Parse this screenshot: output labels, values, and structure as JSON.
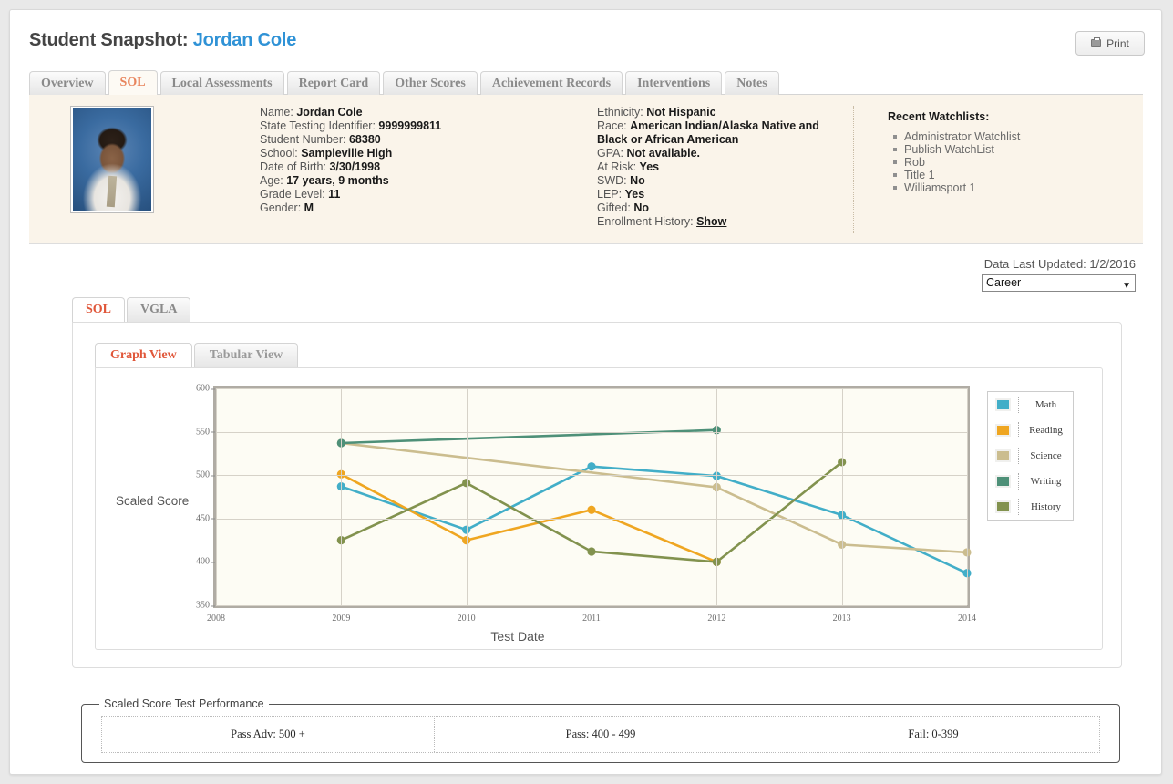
{
  "header": {
    "title_prefix": "Student Snapshot:",
    "student_name": "Jordan Cole",
    "print_label": "Print",
    "accent_link": "#2f92d6"
  },
  "main_tabs": [
    {
      "label": "Overview",
      "active": false
    },
    {
      "label": "SOL",
      "active": true
    },
    {
      "label": "Local Assessments",
      "active": false
    },
    {
      "label": "Report Card",
      "active": false
    },
    {
      "label": "Other Scores",
      "active": false
    },
    {
      "label": "Achievement Records",
      "active": false
    },
    {
      "label": "Interventions",
      "active": false
    },
    {
      "label": "Notes",
      "active": false
    }
  ],
  "student_info": {
    "left": [
      {
        "label": "Name:",
        "value": "Jordan Cole"
      },
      {
        "label": "State Testing Identifier:",
        "value": "9999999811"
      },
      {
        "label": "Student Number:",
        "value": "68380"
      },
      {
        "label": "School:",
        "value": "Sampleville High"
      },
      {
        "label": "Date of Birth:",
        "value": "3/30/1998"
      },
      {
        "label": "Age:",
        "value": "17 years, 9 months"
      },
      {
        "label": "Grade Level:",
        "value": "11"
      },
      {
        "label": "Gender:",
        "value": "M"
      }
    ],
    "right": [
      {
        "label": "Ethnicity:",
        "value": "Not Hispanic"
      },
      {
        "label": "Race:",
        "value": "American Indian/Alaska Native and Black or African American"
      },
      {
        "label": "GPA:",
        "value": "Not available."
      },
      {
        "label": "At Risk:",
        "value": "Yes"
      },
      {
        "label": "SWD:",
        "value": "No"
      },
      {
        "label": "LEP:",
        "value": "Yes"
      },
      {
        "label": "Gifted:",
        "value": "No"
      },
      {
        "label": "Enrollment History:",
        "value": "Show"
      }
    ]
  },
  "watchlists": {
    "title": "Recent Watchlists:",
    "items": [
      "Administrator Watchlist",
      "Publish WatchList",
      "Rob",
      "Title 1",
      "Williamsport 1"
    ]
  },
  "data_updated": "Data Last Updated: 1/2/2016",
  "career_select": {
    "value": "Career",
    "arrow": "▼"
  },
  "sub_tabs": [
    {
      "label": "SOL",
      "active": true
    },
    {
      "label": "VGLA",
      "active": false
    }
  ],
  "view_tabs": [
    {
      "label": "Graph View",
      "active": true
    },
    {
      "label": "Tabular View",
      "active": false
    }
  ],
  "performance": {
    "legend_title": "Scaled Score Test Performance",
    "cells": [
      "Pass Adv: 500 +",
      "Pass: 400 - 499",
      "Fail: 0-399"
    ]
  },
  "chart_data": {
    "type": "line",
    "title": "",
    "xlabel": "Test Date",
    "ylabel": "Scaled Score",
    "x": [
      2008,
      2009,
      2010,
      2011,
      2012,
      2013,
      2014
    ],
    "xticks": [
      "2008",
      "2009",
      "2010",
      "2011",
      "2012",
      "2013",
      "2014"
    ],
    "yticks": [
      350,
      400,
      450,
      500,
      550,
      600
    ],
    "xlim": [
      2008,
      2014
    ],
    "ylim": [
      350,
      600
    ],
    "grid": true,
    "legend_position": "right",
    "series": [
      {
        "name": "Math",
        "color": "#42aec8",
        "points": [
          [
            2009,
            487
          ],
          [
            2010,
            437
          ],
          [
            2011,
            510
          ],
          [
            2012,
            499
          ],
          [
            2013,
            454
          ],
          [
            2014,
            387
          ]
        ]
      },
      {
        "name": "Reading",
        "color": "#efa621",
        "points": [
          [
            2009,
            501
          ],
          [
            2010,
            425
          ],
          [
            2011,
            460
          ],
          [
            2012,
            400
          ]
        ]
      },
      {
        "name": "Science",
        "color": "#cbbd8f",
        "points": [
          [
            2009,
            537
          ],
          [
            2012,
            486
          ],
          [
            2013,
            420
          ],
          [
            2014,
            411
          ]
        ]
      },
      {
        "name": "Writing",
        "color": "#4e9078",
        "points": [
          [
            2009,
            537
          ],
          [
            2012,
            552
          ]
        ]
      },
      {
        "name": "History",
        "color": "#82924e",
        "points": [
          [
            2009,
            425
          ],
          [
            2010,
            491
          ],
          [
            2011,
            412
          ],
          [
            2012,
            400
          ],
          [
            2013,
            515
          ]
        ]
      }
    ]
  }
}
